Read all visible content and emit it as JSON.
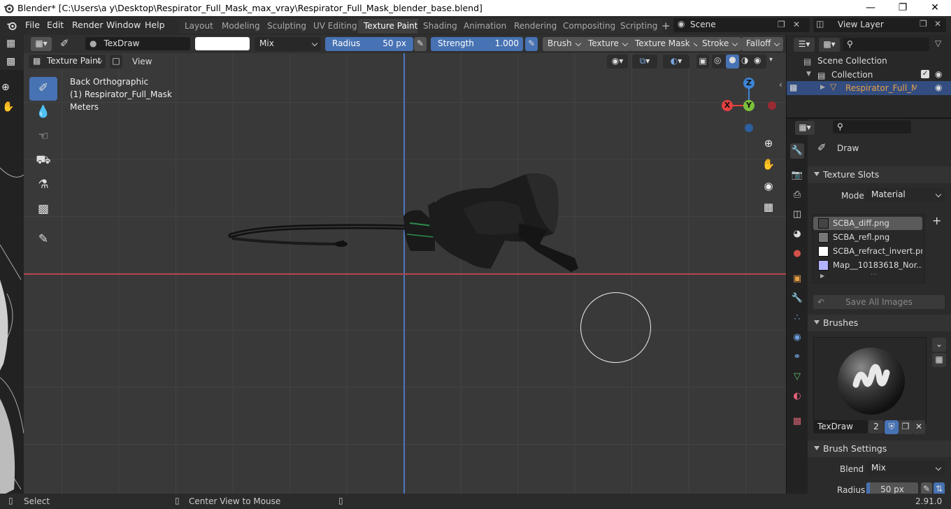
{
  "titlebar": {
    "title": "Blender* [C:\\Users\\a y\\Desktop\\Respirator_Full_Mask_max_vray\\Respirator_Full_Mask_blender_base.blend]"
  },
  "menus": [
    "File",
    "Edit",
    "Render",
    "Window",
    "Help"
  ],
  "workspaces": [
    "Layout",
    "Modeling",
    "Sculpting",
    "UV Editing",
    "Texture Paint",
    "Shading",
    "Animation",
    "Rendering",
    "Compositing",
    "Scripting"
  ],
  "active_workspace": "Texture Paint",
  "scene": {
    "name": "Scene"
  },
  "view_layer": {
    "name": "View Layer"
  },
  "tool_header": {
    "brush_name": "TexDraw",
    "blend": "Mix",
    "radius_label": "Radius",
    "radius_value": "50 px",
    "strength_label": "Strength",
    "strength_value": "1.000",
    "brush": "Brush",
    "texture": "Texture",
    "texture_mask": "Texture Mask",
    "stroke": "Stroke",
    "falloff": "Falloff"
  },
  "mode_bar": {
    "mode": "Texture Paint",
    "view": "View"
  },
  "viewport": {
    "view_name": "Back Orthographic",
    "object_label": "(1) Respirator_Full_Mask",
    "units": "Meters",
    "gizmo": {
      "z": "Z",
      "y": "Y",
      "x": "X"
    }
  },
  "outliner": {
    "scene_collection": "Scene Collection",
    "collection": "Collection",
    "object": "Respirator_Full_Mask"
  },
  "properties": {
    "tool_name": "Draw",
    "texture_slots_title": "Texture Slots",
    "mode_label": "Mode",
    "mode_value": "Material",
    "slots": [
      {
        "name": "SCBA_diff.png",
        "color": "#5a5a5a"
      },
      {
        "name": "SCBA_refl.png",
        "color": "#7a7a7a"
      },
      {
        "name": "SCBA_refract_invert.png",
        "color": "#ffffff"
      },
      {
        "name": "Map__10183618_Nor...",
        "color": "#b3b3ff"
      }
    ],
    "save_all": "Save All Images",
    "brushes_title": "Brushes",
    "brush_name": "TexDraw",
    "brush_users": "2",
    "brush_settings_title": "Brush Settings",
    "blend_label": "Blend",
    "blend_value": "Mix",
    "radius_label": "Radius",
    "radius_value": "50 px"
  },
  "statusbar": {
    "select": "Select",
    "center": "Center View to Mouse",
    "version": "2.91.0"
  },
  "colors": {
    "accent": "#4772b3",
    "active_object": "#e6a045",
    "x_axis": "#e64040",
    "y_axis": "#7bc03a",
    "z_axis": "#3d85d6"
  }
}
